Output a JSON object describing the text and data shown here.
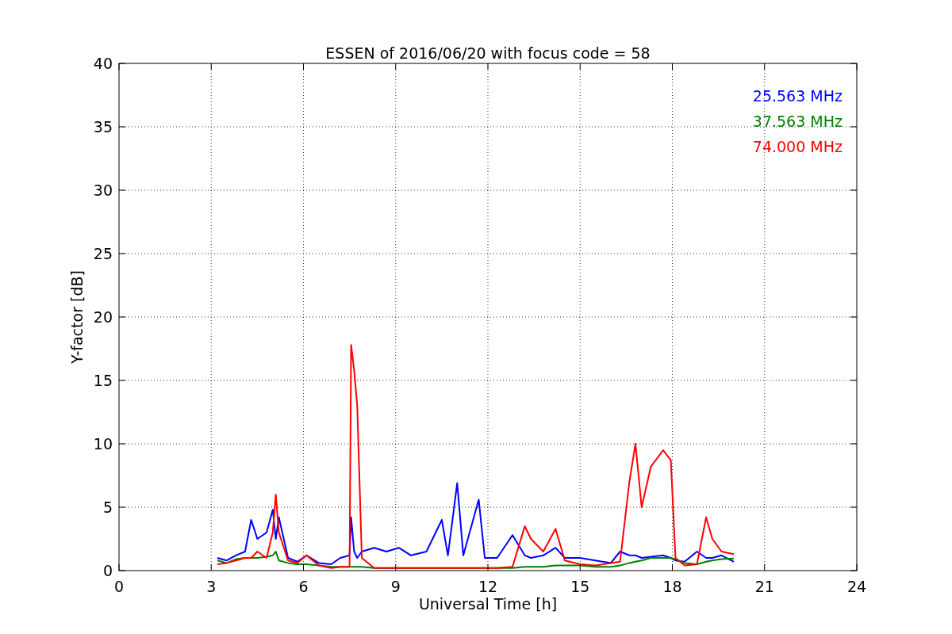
{
  "figure": {
    "chart_data": {
      "type": "line",
      "title": "ESSEN of 2016/06/20 with focus code = 58",
      "xlabel": "Universal Time [h]",
      "ylabel": "Y-factor [dB]",
      "x": [
        3.2,
        3.5,
        3.8,
        4.1,
        4.3,
        4.5,
        4.8,
        5.0,
        5.1,
        5.2,
        5.5,
        5.8,
        6.1,
        6.5,
        6.9,
        7.2,
        7.5,
        7.55,
        7.65,
        7.75,
        7.9,
        8.3,
        8.7,
        9.1,
        9.5,
        10.0,
        10.5,
        10.7,
        11.0,
        11.2,
        11.7,
        11.9,
        12.3,
        12.8,
        13.2,
        13.4,
        13.8,
        14.2,
        14.5,
        15.0,
        15.5,
        16.0,
        16.3,
        16.6,
        16.8,
        17.0,
        17.3,
        17.7,
        17.95,
        18.1,
        18.4,
        18.8,
        19.1,
        19.3,
        19.6,
        20.0
      ],
      "series": [
        {
          "name": "25.563 MHz",
          "color": "#0000ff",
          "values": [
            1.0,
            0.8,
            1.2,
            1.5,
            4.0,
            2.5,
            3.0,
            4.8,
            2.5,
            4.2,
            1.0,
            0.7,
            1.2,
            0.6,
            0.5,
            1.0,
            1.2,
            4.2,
            1.5,
            1.0,
            1.5,
            1.8,
            1.5,
            1.8,
            1.2,
            1.5,
            4.0,
            1.2,
            6.9,
            1.2,
            5.6,
            1.0,
            1.0,
            2.8,
            1.2,
            1.0,
            1.2,
            1.8,
            1.0,
            1.0,
            0.8,
            0.6,
            1.5,
            1.2,
            1.2,
            1.0,
            1.1,
            1.2,
            1.0,
            0.8,
            0.7,
            1.5,
            1.0,
            1.0,
            1.2,
            0.7
          ]
        },
        {
          "name": "37.563 MHz",
          "color": "#008000",
          "values": [
            0.8,
            0.6,
            0.9,
            1.0,
            1.0,
            1.0,
            1.1,
            1.2,
            1.5,
            0.8,
            0.6,
            0.5,
            0.5,
            0.4,
            0.3,
            0.3,
            0.3,
            0.3,
            0.3,
            0.3,
            0.3,
            0.2,
            0.2,
            0.2,
            0.2,
            0.2,
            0.2,
            0.2,
            0.2,
            0.2,
            0.2,
            0.2,
            0.2,
            0.2,
            0.3,
            0.3,
            0.3,
            0.4,
            0.4,
            0.4,
            0.3,
            0.3,
            0.4,
            0.6,
            0.7,
            0.8,
            1.0,
            1.0,
            1.0,
            0.9,
            0.6,
            0.5,
            0.7,
            0.8,
            0.9,
            0.95
          ]
        },
        {
          "name": "74.000 MHz",
          "color": "#ff0000",
          "values": [
            0.5,
            0.6,
            0.8,
            1.0,
            1.0,
            1.5,
            1.0,
            3.0,
            6.0,
            3.0,
            0.8,
            0.6,
            1.2,
            0.4,
            0.2,
            0.3,
            0.3,
            17.8,
            15.8,
            13.0,
            1.0,
            0.2,
            0.2,
            0.2,
            0.2,
            0.2,
            0.2,
            0.2,
            0.2,
            0.2,
            0.2,
            0.2,
            0.2,
            0.3,
            3.5,
            2.5,
            1.5,
            3.3,
            0.8,
            0.5,
            0.4,
            0.6,
            0.7,
            7.0,
            10.0,
            5.0,
            8.2,
            9.5,
            8.7,
            1.0,
            0.4,
            0.5,
            4.2,
            2.5,
            1.5,
            1.3
          ]
        }
      ],
      "xlim": [
        0,
        24
      ],
      "ylim": [
        0,
        40
      ],
      "xticks": [
        0,
        3,
        6,
        9,
        12,
        15,
        18,
        21,
        24
      ],
      "yticks": [
        0,
        5,
        10,
        15,
        20,
        25,
        30,
        35,
        40
      ],
      "grid": true
    }
  }
}
